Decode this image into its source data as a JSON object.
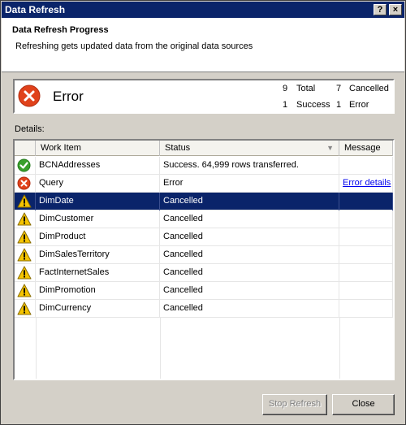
{
  "window": {
    "title": "Data Refresh",
    "help_label": "?",
    "close_label": "×"
  },
  "header": {
    "title": "Data Refresh Progress",
    "subtitle": "Refreshing gets updated data from the original data sources"
  },
  "summary": {
    "status": "Error",
    "total_count": "9",
    "total_label": "Total",
    "cancelled_count": "7",
    "cancelled_label": "Cancelled",
    "success_count": "1",
    "success_label": "Success",
    "error_count": "1",
    "error_label": "Error"
  },
  "details": {
    "label": "Details:",
    "columns": {
      "work_item": "Work Item",
      "status": "Status",
      "message": "Message"
    },
    "rows": [
      {
        "icon": "success-icon",
        "work_item": "BCNAddresses",
        "status": "Success. 64,999 rows transferred.",
        "message": ""
      },
      {
        "icon": "error-icon",
        "work_item": "Query",
        "status": "Error",
        "message": "Error details"
      },
      {
        "icon": "warning-icon",
        "work_item": "DimDate",
        "status": "Cancelled",
        "message": ""
      },
      {
        "icon": "warning-icon",
        "work_item": "DimCustomer",
        "status": "Cancelled",
        "message": ""
      },
      {
        "icon": "warning-icon",
        "work_item": "DimProduct",
        "status": "Cancelled",
        "message": ""
      },
      {
        "icon": "warning-icon",
        "work_item": "DimSalesTerritory",
        "status": "Cancelled",
        "message": ""
      },
      {
        "icon": "warning-icon",
        "work_item": "FactInternetSales",
        "status": "Cancelled",
        "message": ""
      },
      {
        "icon": "warning-icon",
        "work_item": "DimPromotion",
        "status": "Cancelled",
        "message": ""
      },
      {
        "icon": "warning-icon",
        "work_item": "DimCurrency",
        "status": "Cancelled",
        "message": ""
      }
    ]
  },
  "buttons": {
    "stop_refresh": "Stop Refresh",
    "close": "Close"
  },
  "colors": {
    "titlebar": "#0a246a",
    "selection": "#0a246a",
    "error": "#e0421b",
    "success": "#39a02c",
    "warning": "#f5c400"
  }
}
